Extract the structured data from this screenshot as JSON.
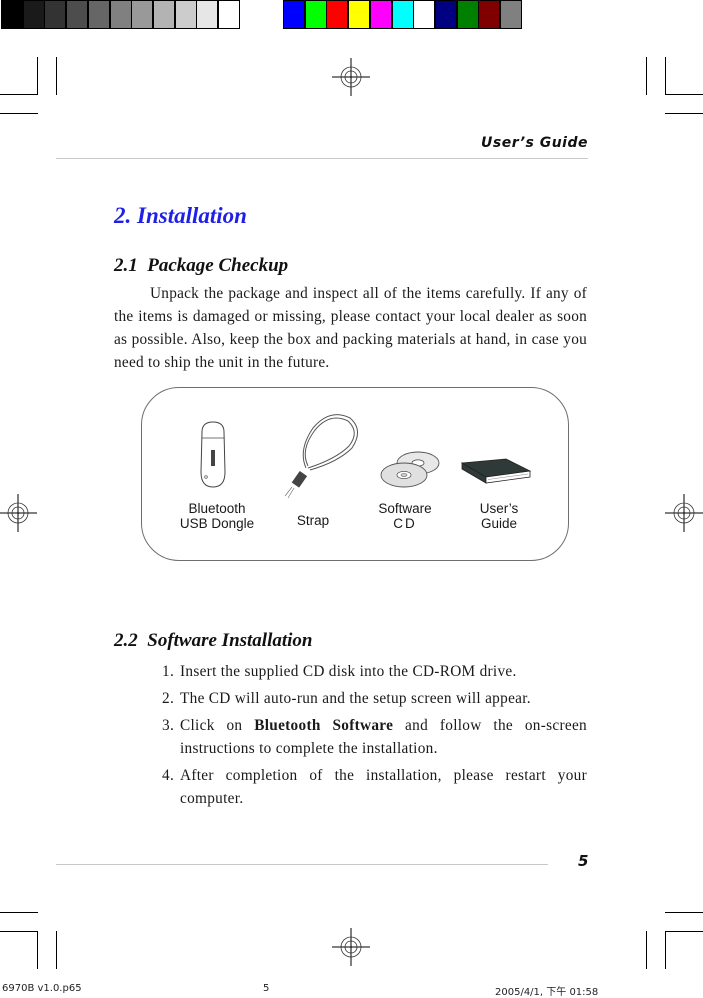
{
  "color_bar": {
    "grayscale": [
      "#000000",
      "#1a1a1a",
      "#333333",
      "#4d4d4d",
      "#666666",
      "#808080",
      "#999999",
      "#b3b3b3",
      "#cccccc",
      "#e6e6e6",
      "#ffffff"
    ],
    "colors": [
      "#0000ff",
      "#00ff00",
      "#ff0000",
      "#ffff00",
      "#ff00ff",
      "#00ffff",
      "#ffffff",
      "#000080",
      "#008000",
      "#800000",
      "#808080"
    ]
  },
  "header": {
    "running_head": "User’s Guide"
  },
  "section": {
    "title": "2. Installation",
    "title_color": "#1f1fe6"
  },
  "package_checkup": {
    "heading": "2.1  Package Checkup",
    "paragraph": "Unpack the package and inspect all of the items carefully. If any of the items is damaged or missing, please contact your local dealer as soon as possible. Also, keep the box and packing materials at hand, in case you need to ship the unit in the future.",
    "items": [
      {
        "icon": "usb-dongle-icon",
        "line1": "Bluetooth",
        "line2": "USB Dongle"
      },
      {
        "icon": "strap-icon",
        "line1": "",
        "line2": "Strap"
      },
      {
        "icon": "cd-icon",
        "line1": "Software",
        "line2": "CD"
      },
      {
        "icon": "book-icon",
        "line1": "User’s",
        "line2": "Guide"
      }
    ]
  },
  "software_installation": {
    "heading": "2.2  Software Installation",
    "steps": [
      {
        "num": "1.",
        "before": "Insert the supplied CD disk into the CD-ROM drive.",
        "bold": "",
        "after": ""
      },
      {
        "num": "2.",
        "before": "The CD will auto-run and the setup screen will appear.",
        "bold": "",
        "after": ""
      },
      {
        "num": "3.",
        "before": "Click on ",
        "bold": "Bluetooth Software",
        "after": " and follow the on-screen instructions to complete the installation."
      },
      {
        "num": "4.",
        "before": "After completion of the installation, please restart your computer.",
        "bold": "",
        "after": ""
      }
    ]
  },
  "footer": {
    "page_number": "5",
    "file_name": "6970B v1.0.p65",
    "sheet_number": "5",
    "timestamp": "2005/4/1, 下午 01:58"
  }
}
